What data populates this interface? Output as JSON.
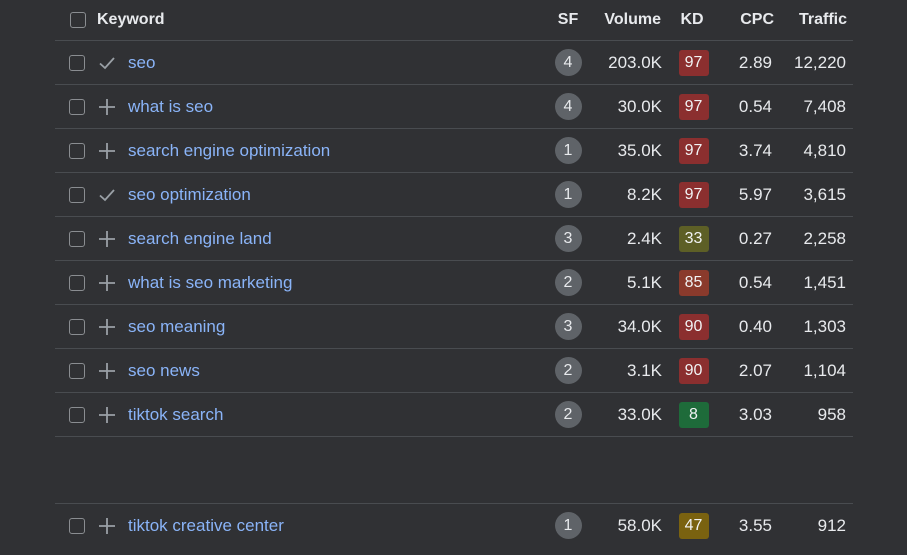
{
  "header": {
    "keyword": "Keyword",
    "sf": "SF",
    "volume": "Volume",
    "kd": "KD",
    "cpc": "CPC",
    "traffic": "Traffic"
  },
  "rows": [
    {
      "keyword": "seo",
      "action_icon": "check-icon",
      "sf": "4",
      "volume": "203.0K",
      "kd": "97",
      "kd_color": "#8b2f2f",
      "cpc": "2.89",
      "traffic": "12,220"
    },
    {
      "keyword": "what is seo",
      "action_icon": "plus-icon",
      "sf": "4",
      "volume": "30.0K",
      "kd": "97",
      "kd_color": "#8b2f2f",
      "cpc": "0.54",
      "traffic": "7,408"
    },
    {
      "keyword": "search engine optimization",
      "action_icon": "plus-icon",
      "sf": "1",
      "volume": "35.0K",
      "kd": "97",
      "kd_color": "#8b2f2f",
      "cpc": "3.74",
      "traffic": "4,810"
    },
    {
      "keyword": "seo optimization",
      "action_icon": "check-icon",
      "sf": "1",
      "volume": "8.2K",
      "kd": "97",
      "kd_color": "#8b2f2f",
      "cpc": "5.97",
      "traffic": "3,615"
    },
    {
      "keyword": "search engine land",
      "action_icon": "plus-icon",
      "sf": "3",
      "volume": "2.4K",
      "kd": "33",
      "kd_color": "#5d5f26",
      "cpc": "0.27",
      "traffic": "2,258"
    },
    {
      "keyword": "what is seo marketing",
      "action_icon": "plus-icon",
      "sf": "2",
      "volume": "5.1K",
      "kd": "85",
      "kd_color": "#8a3a2c",
      "cpc": "0.54",
      "traffic": "1,451"
    },
    {
      "keyword": "seo meaning",
      "action_icon": "plus-icon",
      "sf": "3",
      "volume": "34.0K",
      "kd": "90",
      "kd_color": "#8b2f2f",
      "cpc": "0.40",
      "traffic": "1,303"
    },
    {
      "keyword": "seo news",
      "action_icon": "plus-icon",
      "sf": "2",
      "volume": "3.1K",
      "kd": "90",
      "kd_color": "#8b2f2f",
      "cpc": "2.07",
      "traffic": "1,104"
    },
    {
      "keyword": "tiktok search",
      "action_icon": "plus-icon",
      "sf": "2",
      "volume": "33.0K",
      "kd": "8",
      "kd_color": "#1e6b3a",
      "cpc": "3.03",
      "traffic": "958"
    }
  ],
  "last_row": {
    "keyword": "tiktok creative center",
    "action_icon": "plus-icon",
    "sf": "1",
    "volume": "58.0K",
    "kd": "47",
    "kd_color": "#7a6210",
    "cpc": "3.55",
    "traffic": "912"
  },
  "colors": {
    "background": "#303134",
    "link": "#8ab4f8",
    "divider": "#494c50"
  }
}
